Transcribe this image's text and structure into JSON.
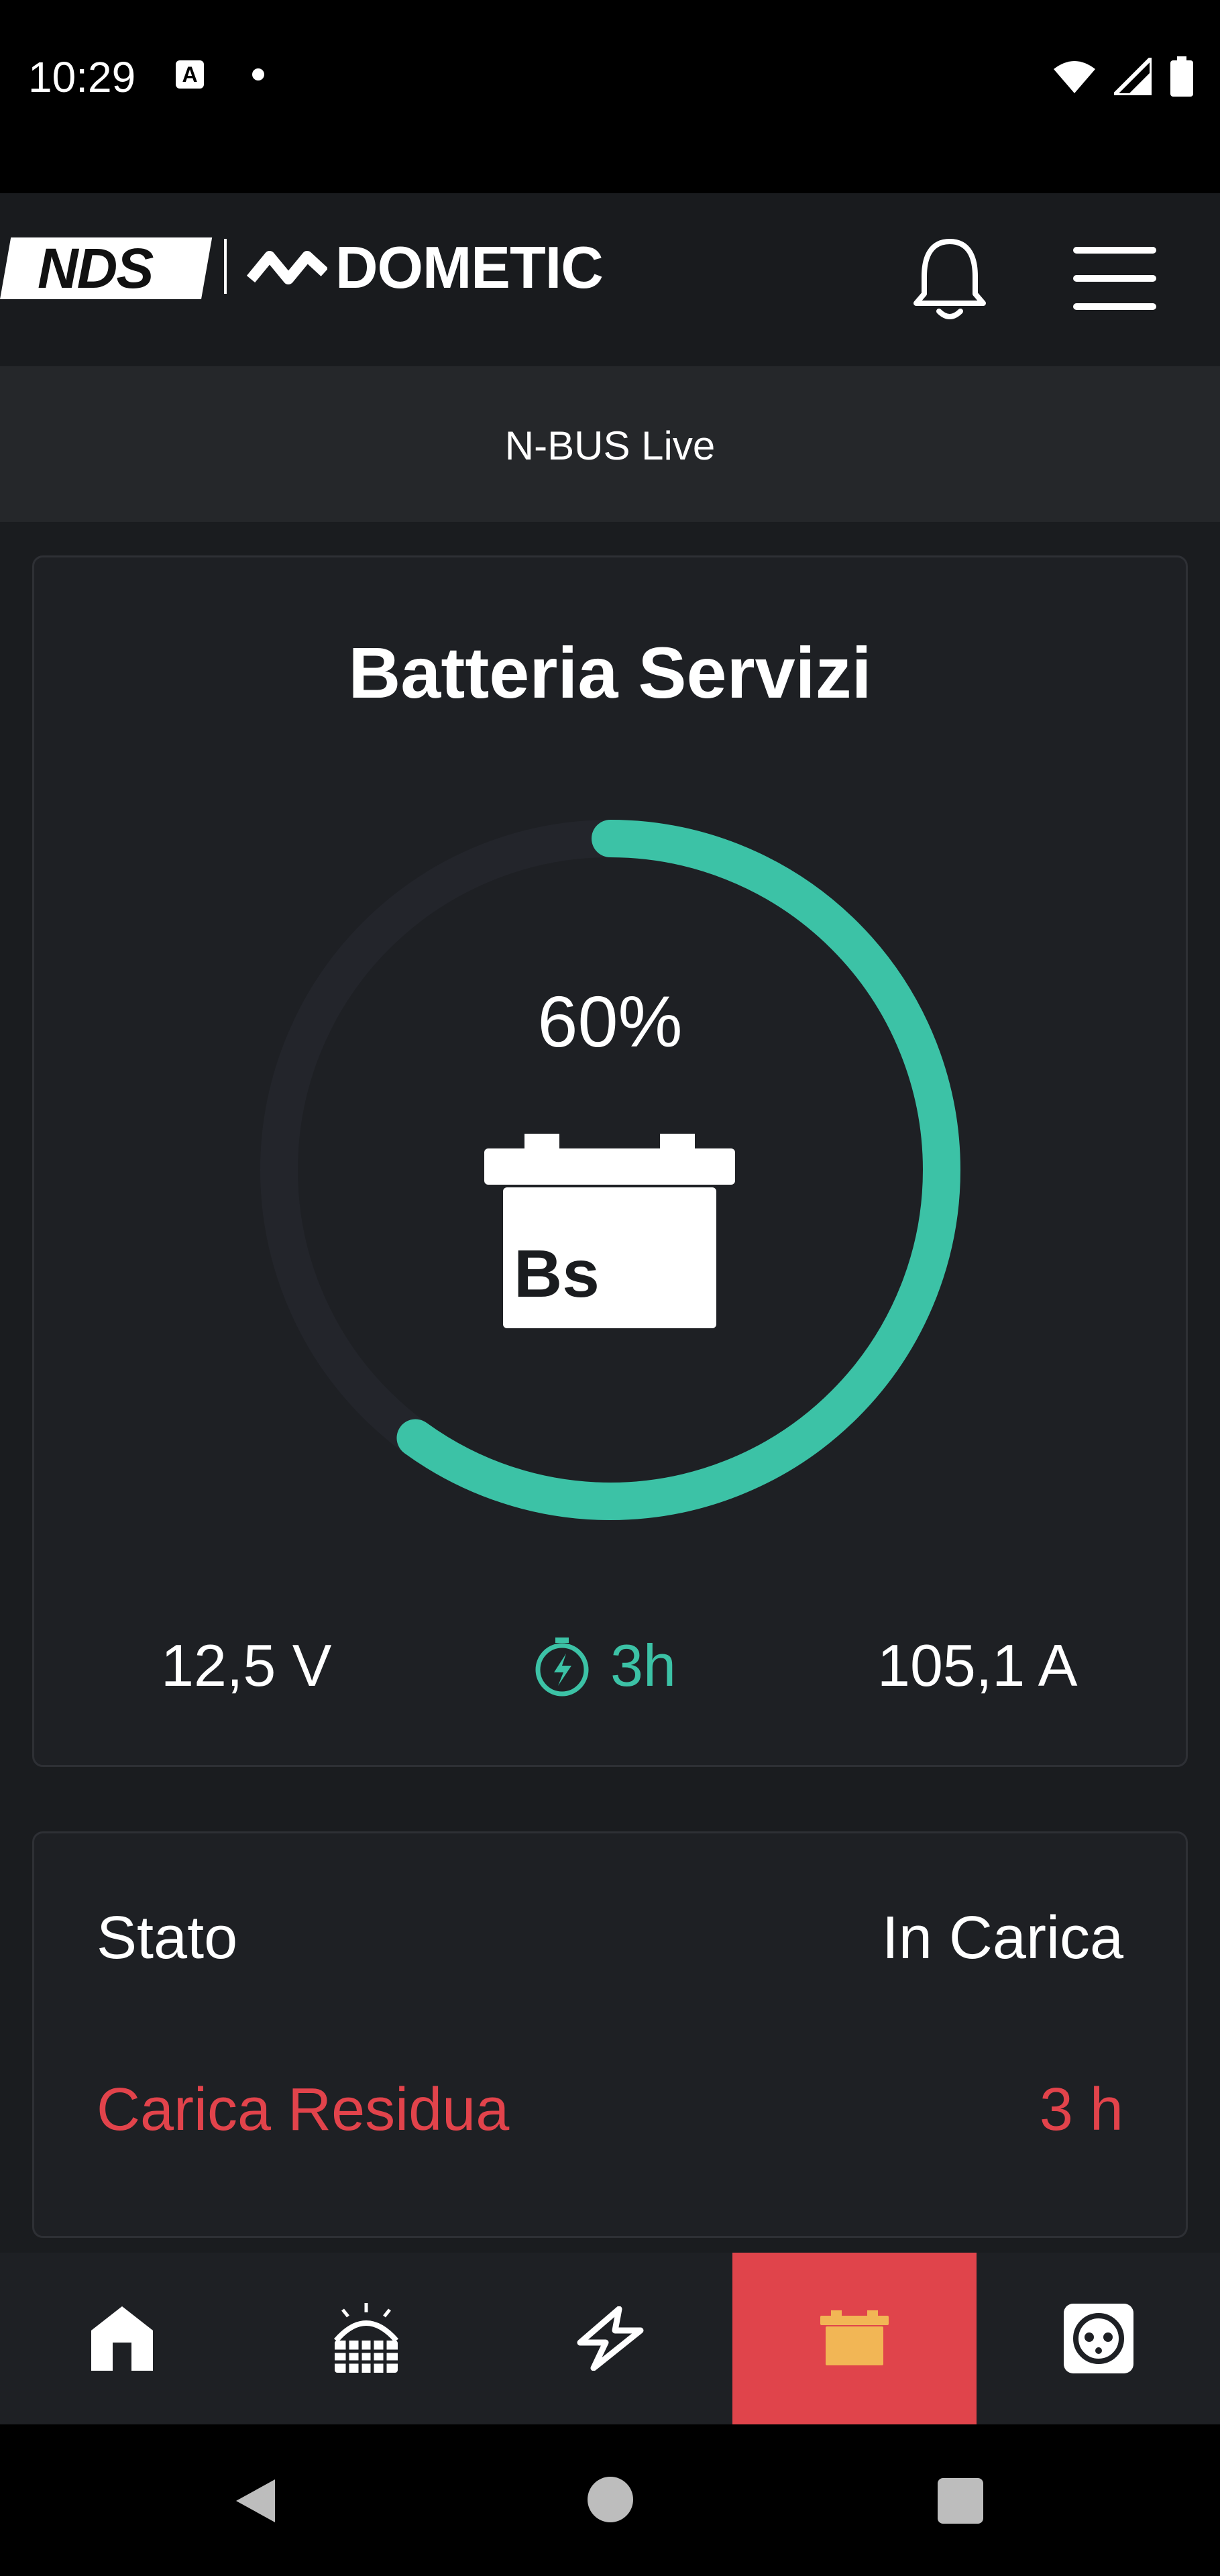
{
  "status_bar": {
    "time": "10:29",
    "notification_icon": "A"
  },
  "header": {
    "brand_left": "NDS",
    "brand_right": "DOMETIC"
  },
  "sub_header": {
    "title": "N-BUS Live"
  },
  "battery": {
    "title": "Batteria Servizi",
    "charge_percent_label": "60%",
    "charge_fraction": 0.6,
    "icon_label": "Bs",
    "voltage": "12,5 V",
    "time_remaining": "3h",
    "current": "105,1 A",
    "accent_color": "#3cc2a6"
  },
  "status_rows": [
    {
      "label": "Stato",
      "value": "In Carica",
      "color": "#ffffff"
    },
    {
      "label": "Carica Residua",
      "value": "3 h",
      "color": "#e2434b"
    }
  ],
  "bottom_nav": {
    "items": [
      "home-icon",
      "heater-icon",
      "power-icon",
      "battery-icon",
      "socket-icon"
    ],
    "active_index": 3,
    "active_color": "#e0444b"
  }
}
